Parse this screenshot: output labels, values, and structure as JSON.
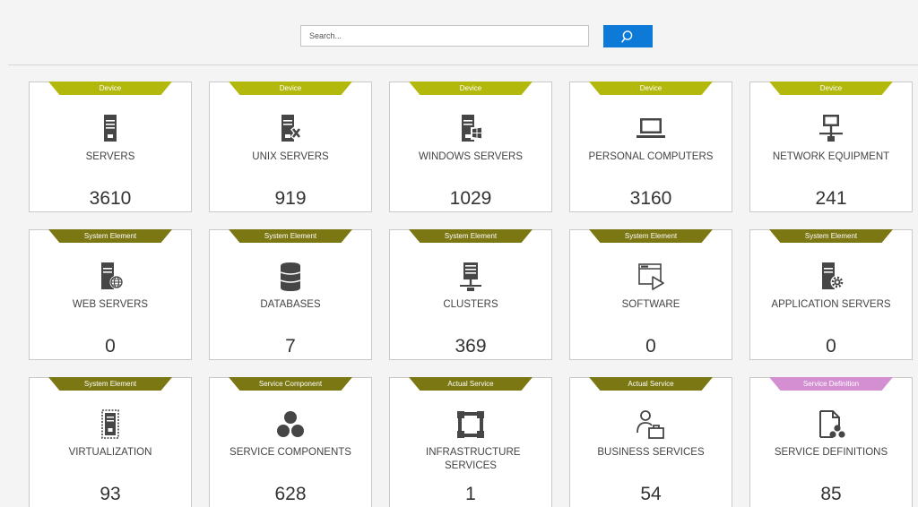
{
  "search": {
    "placeholder": "Search..."
  },
  "icons": {
    "search_button": "search-icon"
  },
  "colors": {
    "device_tag": "#b2b80c",
    "system_tag": "#7b7713",
    "definition_tag": "#d48fd2",
    "search_button": "#0c7ad6",
    "icon": "#464646"
  },
  "tiles": [
    {
      "tag": "Device",
      "title": "SERVERS",
      "count": "3610",
      "icon": "server-icon"
    },
    {
      "tag": "Device",
      "title": "UNIX SERVERS",
      "count": "919",
      "icon": "unix-server-icon"
    },
    {
      "tag": "Device",
      "title": "WINDOWS SERVERS",
      "count": "1029",
      "icon": "windows-server-icon"
    },
    {
      "tag": "Device",
      "title": "PERSONAL COMPUTERS",
      "count": "3160",
      "icon": "computer-icon"
    },
    {
      "tag": "Device",
      "title": "NETWORK EQUIPMENT",
      "count": "241",
      "icon": "network-icon"
    },
    {
      "tag": "System Element",
      "title": "WEB SERVERS",
      "count": "0",
      "icon": "web-server-icon"
    },
    {
      "tag": "System Element",
      "title": "DATABASES",
      "count": "7",
      "icon": "database-icon"
    },
    {
      "tag": "System Element",
      "title": "CLUSTERS",
      "count": "369",
      "icon": "cluster-icon"
    },
    {
      "tag": "System Element",
      "title": "SOFTWARE",
      "count": "0",
      "icon": "software-icon"
    },
    {
      "tag": "System Element",
      "title": "APPLICATION SERVERS",
      "count": "0",
      "icon": "application-server-icon"
    },
    {
      "tag": "System Element",
      "title": "VIRTUALIZATION",
      "count": "93",
      "icon": "virtualization-icon"
    },
    {
      "tag": "Service Component",
      "title": "SERVICE COMPONENTS",
      "count": "628",
      "icon": "service-components-icon"
    },
    {
      "tag": "Actual Service",
      "title": "INFRASTRUCTURE SERVICES",
      "count": "1",
      "icon": "infrastructure-icon"
    },
    {
      "tag": "Actual Service",
      "title": "BUSINESS SERVICES",
      "count": "54",
      "icon": "business-services-icon"
    },
    {
      "tag": "Service Definition",
      "title": "SERVICE DEFINITIONS",
      "count": "85",
      "icon": "service-definitions-icon"
    }
  ]
}
